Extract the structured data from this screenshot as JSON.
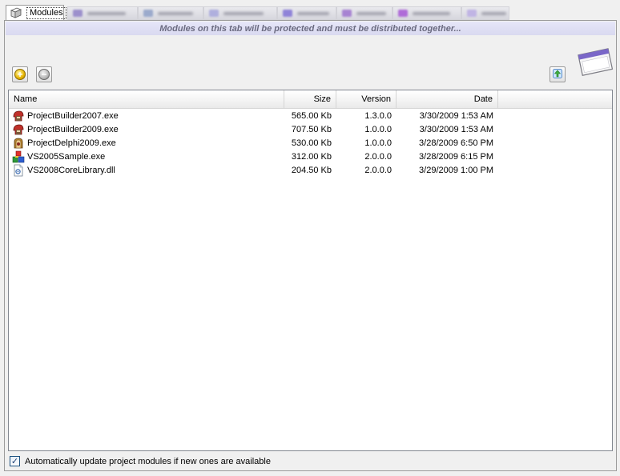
{
  "tabs": {
    "active_label": "Modules"
  },
  "banner": {
    "text": "Modules on this tab will be protected and must be distributed together..."
  },
  "toolbar": {
    "add_icon": "add-circle-icon",
    "remove_icon": "remove-circle-icon",
    "refresh_icon": "refresh-icon"
  },
  "list": {
    "columns": {
      "name": "Name",
      "size": "Size",
      "version": "Version",
      "date": "Date"
    },
    "rows": [
      {
        "name": "ProjectBuilder2007.exe",
        "size": "565.00 Kb",
        "version": "1.3.0.0",
        "date": "3/30/2009 1:53 AM",
        "icon": "helmet-icon"
      },
      {
        "name": "ProjectBuilder2009.exe",
        "size": "707.50 Kb",
        "version": "1.0.0.0",
        "date": "3/30/2009 1:53 AM",
        "icon": "helmet-icon"
      },
      {
        "name": "ProjectDelphi2009.exe",
        "size": "530.00 Kb",
        "version": "1.0.0.0",
        "date": "3/28/2009 6:50 PM",
        "icon": "delphi-icon"
      },
      {
        "name": "VS2005Sample.exe",
        "size": "312.00 Kb",
        "version": "2.0.0.0",
        "date": "3/28/2009 6:15 PM",
        "icon": "blocks-icon"
      },
      {
        "name": "VS2008CoreLibrary.dll",
        "size": "204.50 Kb",
        "version": "2.0.0.0",
        "date": "3/29/2009 1:00 PM",
        "icon": "dll-icon"
      }
    ]
  },
  "footer": {
    "auto_update_label": "Automatically update project modules if new ones are available",
    "auto_update_checked": true
  },
  "colors": {
    "banner_bg": "#dcdcf2",
    "banner_text": "#6a6a80",
    "panel_border": "#9b9b9b"
  }
}
